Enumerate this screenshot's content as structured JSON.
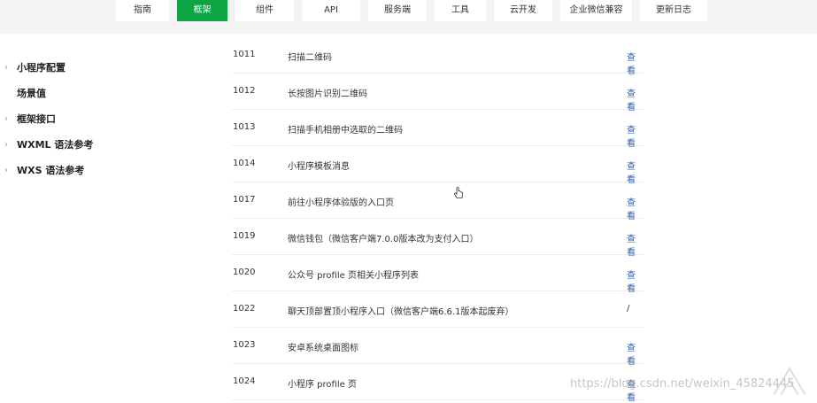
{
  "nav": {
    "tabs": [
      {
        "label": "指南",
        "active": false
      },
      {
        "label": "框架",
        "active": true
      },
      {
        "label": "组件",
        "active": false
      },
      {
        "label": "API",
        "active": false
      },
      {
        "label": "服务端",
        "active": false
      },
      {
        "label": "工具",
        "active": false
      },
      {
        "label": "云开发",
        "active": false
      },
      {
        "label": "企业微信兼容",
        "active": false
      },
      {
        "label": "更新日志",
        "active": false
      }
    ]
  },
  "sidebar": {
    "items": [
      {
        "label": "小程序配置",
        "expandable": true
      },
      {
        "label": "场景值",
        "expandable": false
      },
      {
        "label": "框架接口",
        "expandable": true
      },
      {
        "label": "WXML 语法参考",
        "expandable": true
      },
      {
        "label": "WXS 语法参考",
        "expandable": true
      }
    ]
  },
  "table": {
    "rows": [
      {
        "code": "1011",
        "desc": "扫描二维码",
        "action": "查看"
      },
      {
        "code": "1012",
        "desc": "长按图片识别二维码",
        "action": "查看"
      },
      {
        "code": "1013",
        "desc": "扫描手机相册中选取的二维码",
        "action": "查看"
      },
      {
        "code": "1014",
        "desc": "小程序模板消息",
        "action": "查看"
      },
      {
        "code": "1017",
        "desc": "前往小程序体验版的入口页",
        "action": "查看"
      },
      {
        "code": "1019",
        "desc": "微信钱包（微信客户端7.0.0版本改为支付入口）",
        "action": "查看"
      },
      {
        "code": "1020",
        "desc": "公众号 profile 页相关小程序列表",
        "action": "查看"
      },
      {
        "code": "1022",
        "desc": "聊天顶部置顶小程序入口（微信客户端6.6.1版本起废弃）",
        "action": "/"
      },
      {
        "code": "1023",
        "desc": "安卓系统桌面图标",
        "action": "查看"
      },
      {
        "code": "1024",
        "desc": "小程序 profile 页",
        "action": "查看"
      }
    ]
  },
  "watermark": {
    "text": "https://blog.csdn.net/weixin_45824445"
  },
  "colors": {
    "accent": "#0da544",
    "link": "#2f5ea9",
    "topbar": "#f3f3f3"
  }
}
